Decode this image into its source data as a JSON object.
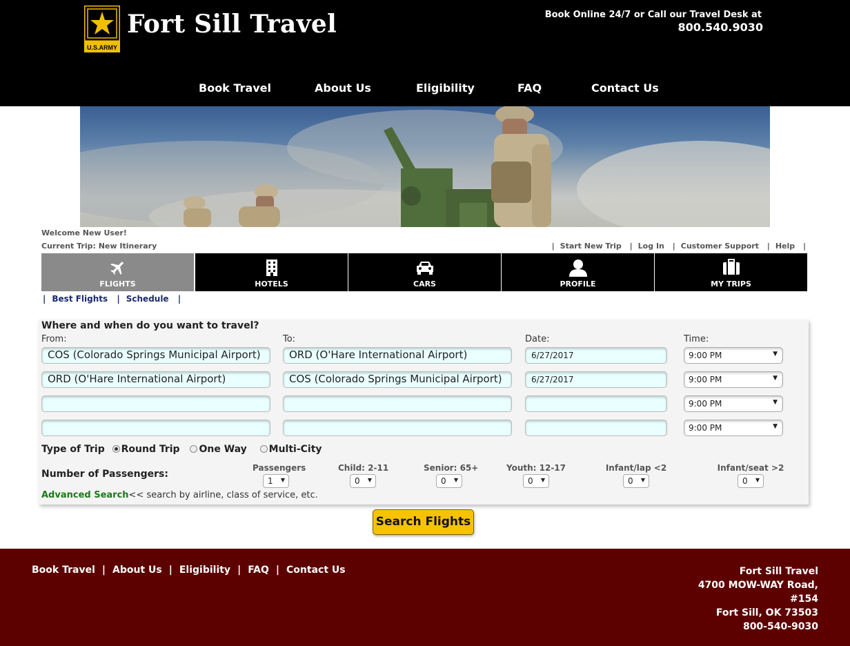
{
  "header": {
    "logo_text": "U.S.ARMY",
    "title": "Fort Sill Travel",
    "book_online": "Book Online 24/7 or Call our Travel Desk at",
    "phone": "800.540.9030",
    "nav": [
      "Book Travel",
      "About Us",
      "Eligibility",
      "FAQ",
      "Contact Us"
    ]
  },
  "info": {
    "welcome": "Welcome New User!",
    "current_trip": "Current Trip: New Itinerary",
    "links": [
      "Start New Trip",
      "Log In",
      "Customer Support",
      "Help"
    ]
  },
  "tabs": [
    {
      "label": "FLIGHTS",
      "icon": "plane-icon"
    },
    {
      "label": "HOTELS",
      "icon": "building-icon"
    },
    {
      "label": "CARS",
      "icon": "car-icon"
    },
    {
      "label": "PROFILE",
      "icon": "person-icon"
    },
    {
      "label": "MY TRIPS",
      "icon": "suitcase-icon"
    }
  ],
  "sublinks": [
    "Best Flights",
    "Schedule"
  ],
  "search": {
    "question": "Where and when do you want to travel?",
    "labels": {
      "from": "From:",
      "to": "To:",
      "date": "Date:",
      "time": "Time:"
    },
    "rows": [
      {
        "from": "COS (Colorado Springs Municipal Airport)",
        "to": "ORD (O'Hare International Airport)",
        "date": "6/27/2017",
        "time": "9:00 PM"
      },
      {
        "from": "ORD (O'Hare International Airport)",
        "to": "COS (Colorado Springs Municipal Airport)",
        "date": "6/27/2017",
        "time": "9:00 PM"
      },
      {
        "from": "",
        "to": "",
        "date": "",
        "time": "9:00 PM"
      },
      {
        "from": "",
        "to": "",
        "date": "",
        "time": "9:00 PM"
      }
    ],
    "trip_type_label": "Type of Trip",
    "trip_types": [
      "Round Trip",
      "One Way",
      "Multi-City"
    ],
    "selected_trip_type": "Round Trip",
    "passengers_label": "Number of Passengers:",
    "passenger_types": [
      {
        "label": "Passengers",
        "value": "1"
      },
      {
        "label": "Child: 2-11",
        "value": "0"
      },
      {
        "label": "Senior: 65+",
        "value": "0"
      },
      {
        "label": "Youth: 12-17",
        "value": "0"
      },
      {
        "label": "Infant/lap <2",
        "value": "0"
      },
      {
        "label": "Infant/seat >2",
        "value": "0"
      }
    ],
    "advanced_link": "Advanced Search",
    "advanced_hint": "<< search by airline, class of service, etc.",
    "button": "Search Flights"
  },
  "footer": {
    "nav": [
      "Book Travel",
      "About Us",
      "Eligibility",
      "FAQ",
      "Contact Us"
    ],
    "address": [
      "Fort Sill Travel",
      "4700 MOW-WAY Road,",
      "#154",
      "Fort Sill, OK 73503",
      "800-540-9030"
    ]
  }
}
